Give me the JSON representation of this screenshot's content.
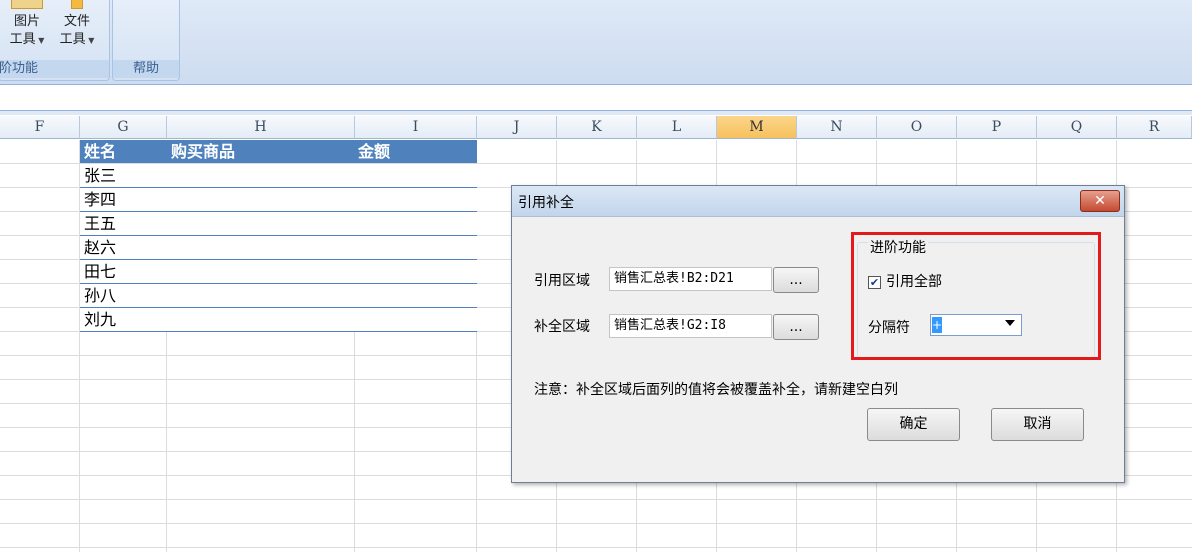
{
  "ribbon": {
    "btn_picture_tool": [
      "图片",
      "工具"
    ],
    "btn_file_tool": [
      "文件",
      "工具"
    ],
    "group_left_label": "阶功能",
    "group_help_label": "帮助"
  },
  "columns": [
    "F",
    "G",
    "H",
    "I",
    "J",
    "K",
    "L",
    "M",
    "N",
    "O",
    "P",
    "Q",
    "R"
  ],
  "selected_column": "M",
  "table": {
    "headers": [
      "姓名",
      "购买商品",
      "金额"
    ],
    "rows": [
      [
        "张三",
        "",
        ""
      ],
      [
        "李四",
        "",
        ""
      ],
      [
        "王五",
        "",
        ""
      ],
      [
        "赵六",
        "",
        ""
      ],
      [
        "田七",
        "",
        ""
      ],
      [
        "孙八",
        "",
        ""
      ],
      [
        "刘九",
        "",
        ""
      ]
    ]
  },
  "dialog": {
    "title": "引用补全",
    "close_label": "✕",
    "ref_label": "引用区域",
    "ref_value": "销售汇总表!B2:D21",
    "fill_label": "补全区域",
    "fill_value": "销售汇总表!G2:I8",
    "browse_label": "...",
    "advanced_title": "进阶功能",
    "ref_all_label": "引用全部",
    "ref_all_checked": true,
    "separator_label": "分隔符",
    "separator_value": "+",
    "note": "注意：补全区域后面列的值将会被覆盖补全，请新建空白列",
    "ok_label": "确定",
    "cancel_label": "取消"
  },
  "colors": {
    "header_blue": "#4f81bd",
    "highlight_red": "#e3191c",
    "selected_col": "#f7c15d"
  }
}
